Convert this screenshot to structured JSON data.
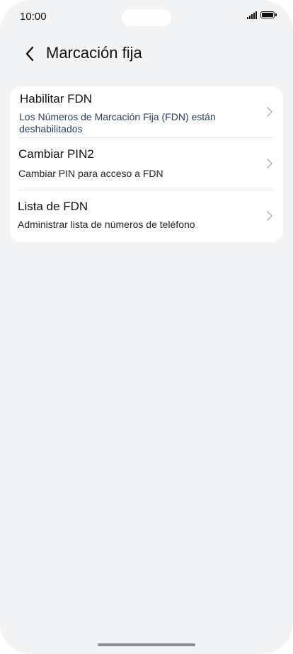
{
  "status_bar": {
    "time": "10:00",
    "icons": [
      "signal-icon",
      "battery-icon"
    ]
  },
  "header": {
    "back_icon": "chevron-left-icon",
    "title": "Marcación fija"
  },
  "items": [
    {
      "title": "Habilitar FDN",
      "subtitle": "Los Números de Marcación Fija (FDN) están deshabilitados",
      "chevron_icon": "chevron-right-icon"
    },
    {
      "title": "Cambiar PIN2",
      "subtitle": "Cambiar PIN para acceso a FDN",
      "chevron_icon": "chevron-right-icon"
    },
    {
      "title": "Lista de FDN",
      "subtitle": "Administrar lista de números de teléfono",
      "chevron_icon": "chevron-right-icon"
    }
  ],
  "colors": {
    "background": "#f1f3f5",
    "card": "#ffffff",
    "text": "#111111",
    "subtitle_accent": "#2a3f66",
    "chevron": "#b5b8bc"
  }
}
